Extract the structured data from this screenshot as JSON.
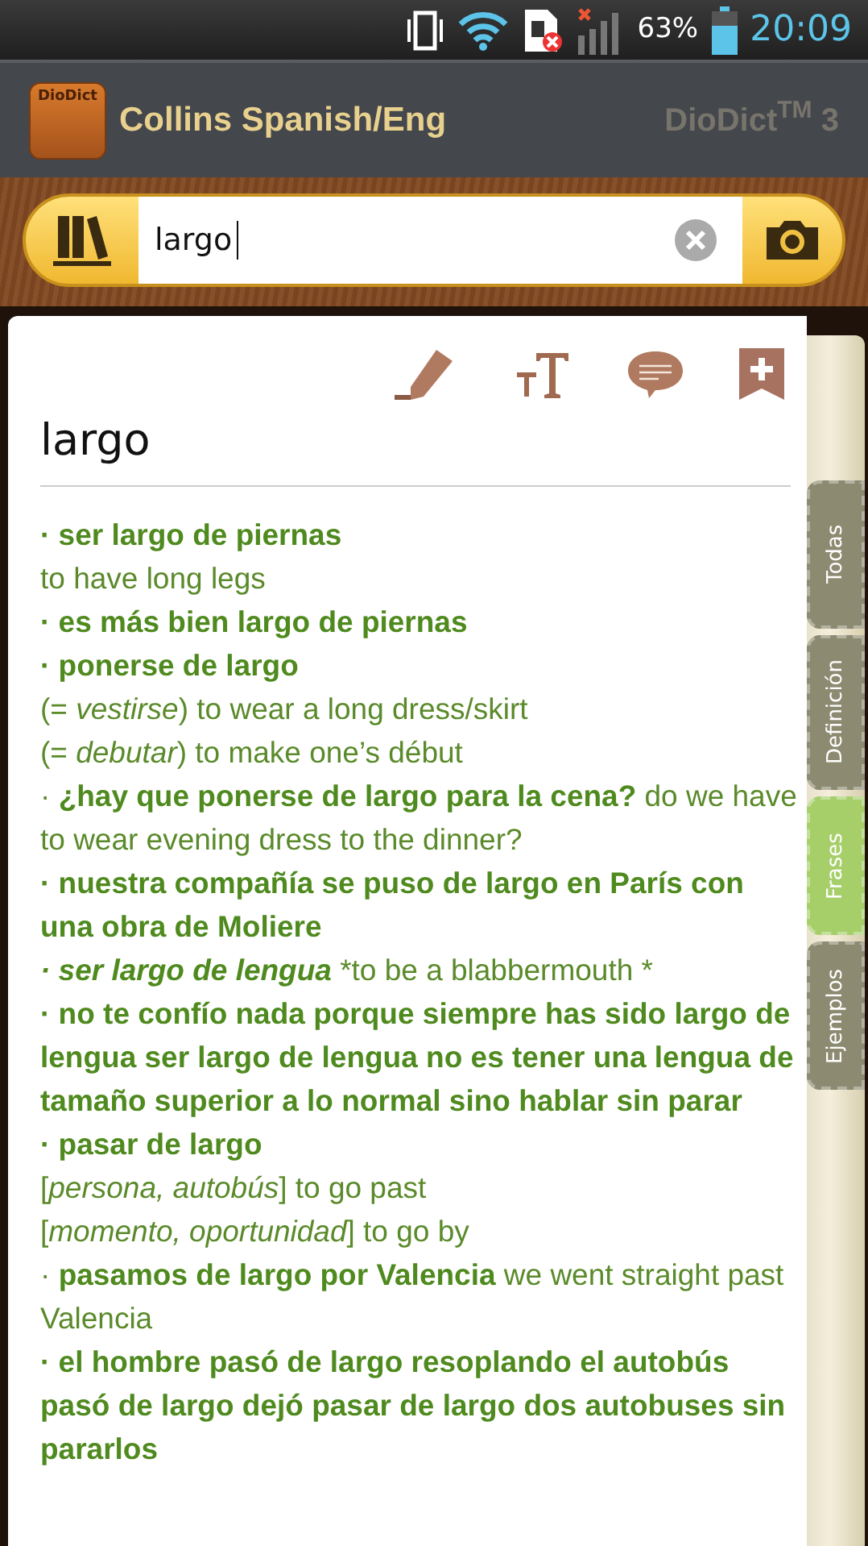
{
  "status_bar": {
    "battery_text": "63%",
    "time": "20:09"
  },
  "header": {
    "app_icon_label": "DioDict",
    "title": "Collins Spanish/Eng",
    "brand": "DioDict$^{TM}$ 3"
  },
  "search": {
    "value": "largo"
  },
  "entry": {
    "headword": "largo",
    "lines": [
      {
        "kind": "phrase",
        "text": "· ser largo de piernas"
      },
      {
        "kind": "translation",
        "text": "to have long legs"
      },
      {
        "kind": "phrase",
        "text": "· es más bien largo de piernas"
      },
      {
        "kind": "phrase",
        "text": "· ponerse de largo"
      },
      {
        "kind": "translation",
        "text": "(= *vestirse*) to wear a long dress/skirt"
      },
      {
        "kind": "translation",
        "text": "(= *debutar*) to make one’s début"
      },
      {
        "kind": "translation",
        "text": "· **¿hay que ponerse de largo para la cena?** do we have to wear evening dress to the dinner?"
      },
      {
        "kind": "phrase",
        "text": "· nuestra compañía se puso de largo en París con una obra de Moliere"
      },
      {
        "kind": "idiom",
        "text": "· ser largo de lengua",
        "gloss": "*to be a blabbermouth *"
      },
      {
        "kind": "phrase",
        "text": "· no te confío nada porque siempre has sido largo de lengua ser largo de lengua no es tener una lengua de tamaño superior a lo normal sino hablar sin parar"
      },
      {
        "kind": "phrase",
        "text": "· pasar de largo"
      },
      {
        "kind": "translation",
        "text": "[*persona, autobús*] to go past"
      },
      {
        "kind": "translation",
        "text": "[*momento, oportunidad*] to go by"
      },
      {
        "kind": "translation",
        "text": "· **pasamos de largo por Valencia** we went straight past Valencia"
      },
      {
        "kind": "phrase",
        "text": "· el hombre pasó de largo resoplando el autobús pasó de largo dejó pasar de largo dos autobuses sin pararlos"
      }
    ]
  },
  "side_tabs": [
    {
      "label": "Todas",
      "selected": false
    },
    {
      "label": "Definición",
      "selected": false
    },
    {
      "label": "Frases",
      "selected": true
    },
    {
      "label": "Ejemplos",
      "selected": false
    }
  ]
}
